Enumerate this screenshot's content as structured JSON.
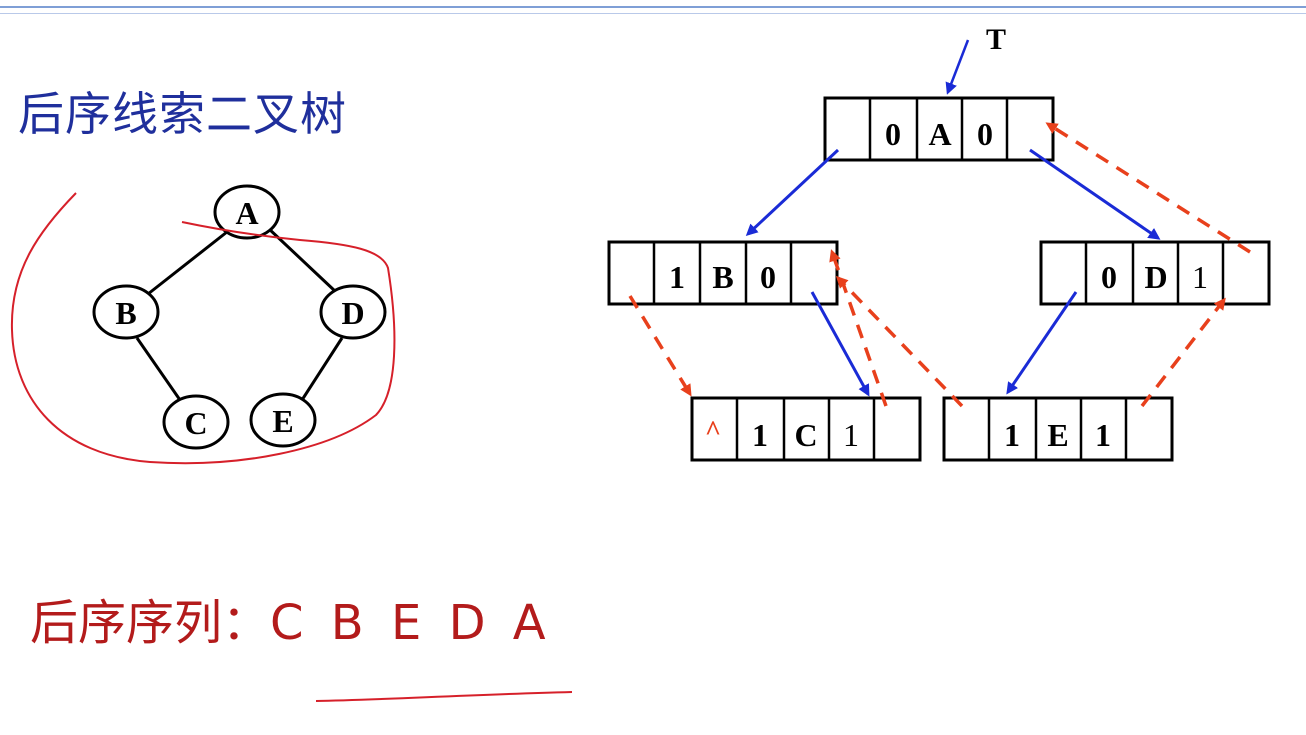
{
  "title": "后序线索二叉树",
  "sequence": {
    "label": "后序序列：",
    "value": "C B E D A"
  },
  "tree": {
    "nodes": [
      "A",
      "B",
      "D",
      "C",
      "E"
    ]
  },
  "pointer_label": "T",
  "null_mark": "^",
  "records": {
    "A": {
      "ltag": "0",
      "data": "A",
      "rtag": "0"
    },
    "B": {
      "ltag": "1",
      "data": "B",
      "rtag": "0"
    },
    "D": {
      "ltag": "0",
      "data": "D",
      "rtag": "1"
    },
    "C": {
      "ltag": "1",
      "data": "C",
      "rtag": "1"
    },
    "E": {
      "ltag": "1",
      "data": "E",
      "rtag": "1"
    }
  },
  "colors": {
    "title": "#1f2f9c",
    "sequence": "#b31b1b",
    "child_link": "#1a2bd6",
    "thread_link": "#e8401c",
    "annotation": "#d6202a"
  }
}
